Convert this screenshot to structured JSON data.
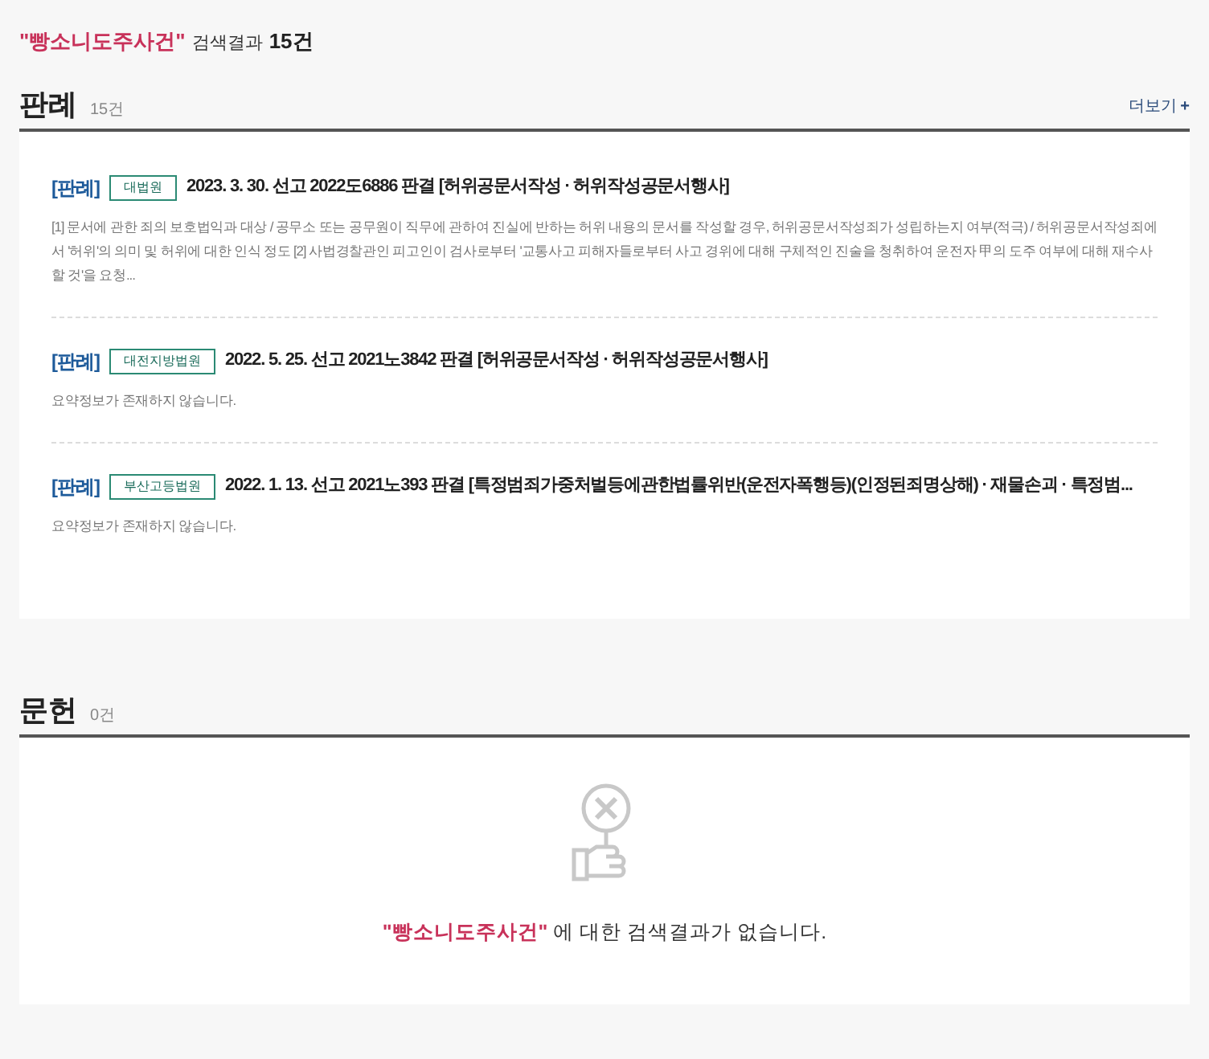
{
  "header": {
    "query": "\"빵소니도주사건\"",
    "label": "검색결과",
    "count": "15건"
  },
  "sections": [
    {
      "title": "판례",
      "count": "15건",
      "more": "더보기",
      "more_icon": "+",
      "items": [
        {
          "tag": "[판례]",
          "court": "대법원",
          "title": "2023. 3. 30. 선고 2022도6886 판결 [허위공문서작성 · 허위작성공문서행사]",
          "summary": "[1] 문서에 관한 죄의 보호법익과 대상 / 공무소 또는 공무원이 직무에 관하여 진실에 반하는 허위 내용의 문서를 작성할 경우, 허위공문서작성죄가 성립하는지 여부(적극) / 허위공문서작성죄에서 '허위'의 의미 및 허위에 대한 인식 정도 [2] 사법경찰관인 피고인이 검사로부터 '교통사고 피해자들로부터 사고 경위에 대해 구체적인 진술을 청취하여 운전자 甲의 도주 여부에 대해 재수사할 것'을 요청..."
        },
        {
          "tag": "[판례]",
          "court": "대전지방법원",
          "title": "2022. 5. 25. 선고 2021노3842 판결 [허위공문서작성 · 허위작성공문서행사]",
          "summary": "요약정보가 존재하지 않습니다."
        },
        {
          "tag": "[판례]",
          "court": "부산고등법원",
          "title": "2022. 1. 13. 선고 2021노393 판결 [특정범죄가중처벌등에관한법률위반(운전자폭행등)(인정된죄명상해) · 재물손괴 · 특정범...",
          "summary": "요약정보가 존재하지 않습니다."
        }
      ]
    },
    {
      "title": "문헌",
      "count": "0건",
      "empty": {
        "query": "\"빵소니도주사건\"",
        "message": "에 대한 검색결과가 없습니다."
      }
    }
  ]
}
